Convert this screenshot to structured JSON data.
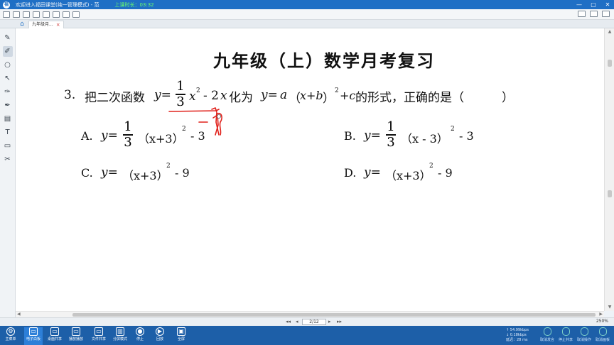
{
  "window": {
    "title": "欢迎进入福田课堂(纯一管理模式) - 范",
    "timer": "上课时长：03:32"
  },
  "tabs": {
    "doc_tab": "九年级月...",
    "close": "×"
  },
  "tools": [
    "pen",
    "highlighter",
    "eraser",
    "pointer",
    "brush",
    "ink",
    "delete",
    "text",
    "image",
    "scissors"
  ],
  "board": {
    "heading": "九年级（上）数学月考复习",
    "question": {
      "number": "3.",
      "lead": "把二次函数",
      "y_eq": "y=",
      "frac_num": "1",
      "frac_den": "3",
      "x": "x",
      "exp": "2",
      "rest1": "- 2",
      "x2": "x",
      "middle": "化为",
      "form_y": "y=",
      "form_a": "a",
      "form_paren": "（",
      "form_xb": "x+b",
      "form_close": "）",
      "form_exp": "2",
      "form_plus_c": "+c",
      "tail": "的形式，正确的是（",
      "blank_close": "）"
    },
    "options": {
      "a": {
        "label": "A.",
        "y": "y=",
        "num": "1",
        "den": "3",
        "body": "（x+3）",
        "exp": "2",
        "tail": "- 3"
      },
      "b": {
        "label": "B.",
        "y": "y=",
        "num": "1",
        "den": "3",
        "body": "（x - 3）",
        "exp": "2",
        "tail": "- 3"
      },
      "c": {
        "label": "C.",
        "y": "y=",
        "body": "（x+3）",
        "exp": "2",
        "tail": "- 9"
      },
      "d": {
        "label": "D.",
        "y": "y=",
        "body": "（x+3）",
        "exp": "2",
        "tail": "- 9"
      }
    },
    "annotation_color": "#e0201a"
  },
  "pagebar": {
    "first": "◂◂",
    "prev": "◂",
    "page": "2/12",
    "next": "▸",
    "last": "▸▸",
    "zoom": "250%"
  },
  "taskbar": {
    "items": [
      {
        "label": "主菜单",
        "icon": "⚙"
      },
      {
        "label": "电子白板",
        "icon": "▭"
      },
      {
        "label": "桌面共享",
        "icon": "▭"
      },
      {
        "label": "播放播放",
        "icon": "▭"
      },
      {
        "label": "文件共享",
        "icon": "▭"
      },
      {
        "label": "分屏模式",
        "icon": "▥"
      },
      {
        "label": "停止",
        "icon": "●"
      },
      {
        "label": "回放",
        "icon": "▶"
      },
      {
        "label": "全屏",
        "icon": "▣"
      }
    ],
    "net": {
      "up": "↑ 54.99kbps",
      "down": "↓ 0.18kbps",
      "delay": "延迟：28 ms"
    },
    "right": [
      {
        "label": "取消发言"
      },
      {
        "label": "停止共享"
      },
      {
        "label": "取消操作"
      },
      {
        "label": "取消画板"
      }
    ]
  }
}
